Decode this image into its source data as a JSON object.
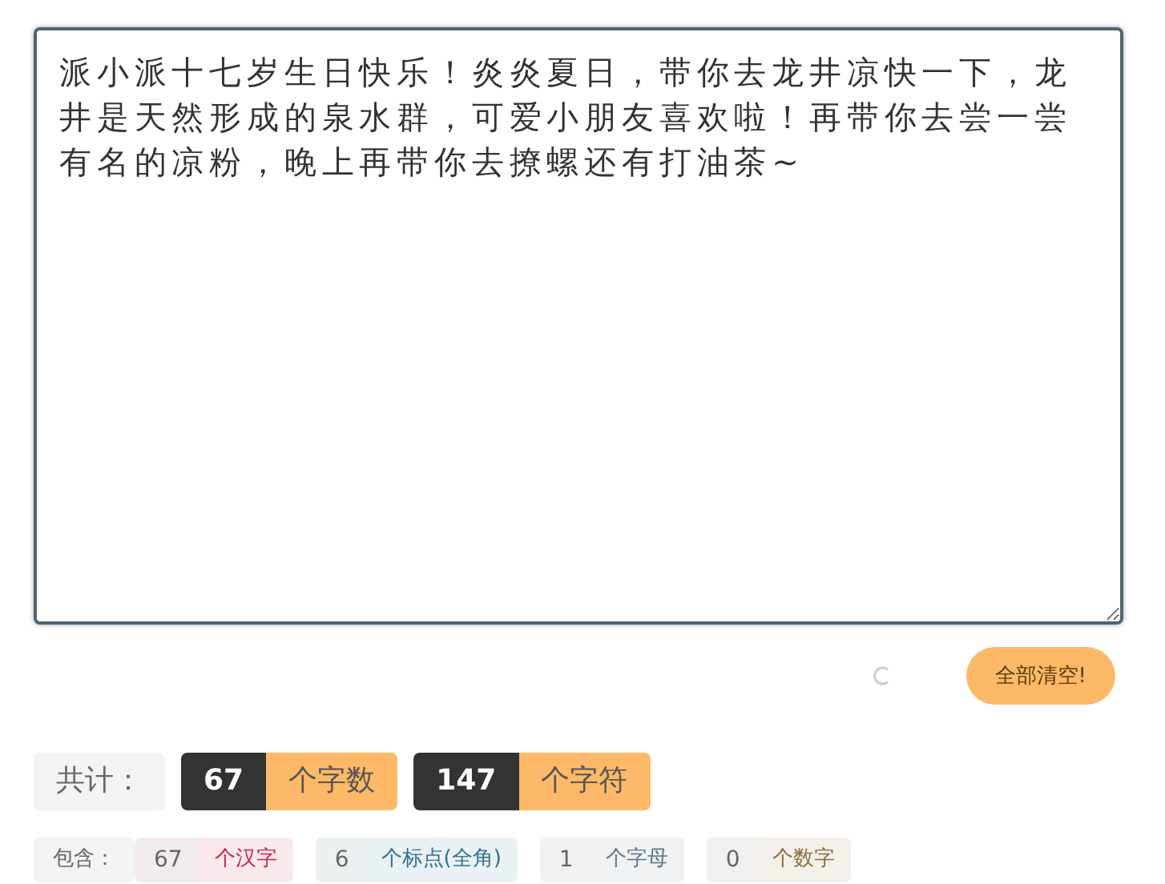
{
  "editor": {
    "value": "派小派十七岁生日快乐！炎炎夏日，带你去龙井凉快一下，龙井是天然形成的泉水群，可爱小朋友喜欢啦！再带你去尝一尝有名的凉粉，晚上再带你去撩螺还有打油茶~"
  },
  "loading": true,
  "clear_button": "全部清空!",
  "totals": {
    "label": "共计：",
    "items": [
      {
        "count": "67",
        "unit": "个字数"
      },
      {
        "count": "147",
        "unit": "个字符"
      }
    ]
  },
  "details": {
    "label": "包含：",
    "items": [
      {
        "count": "67",
        "unit": "个汉字",
        "color": "#c7254e"
      },
      {
        "count": "6",
        "unit": "个标点(全角)",
        "color": "#31708f"
      },
      {
        "count": "1",
        "unit": "个字母",
        "color": "#5f7385"
      },
      {
        "count": "0",
        "unit": "个数字",
        "color": "#8a6d3b"
      }
    ]
  }
}
